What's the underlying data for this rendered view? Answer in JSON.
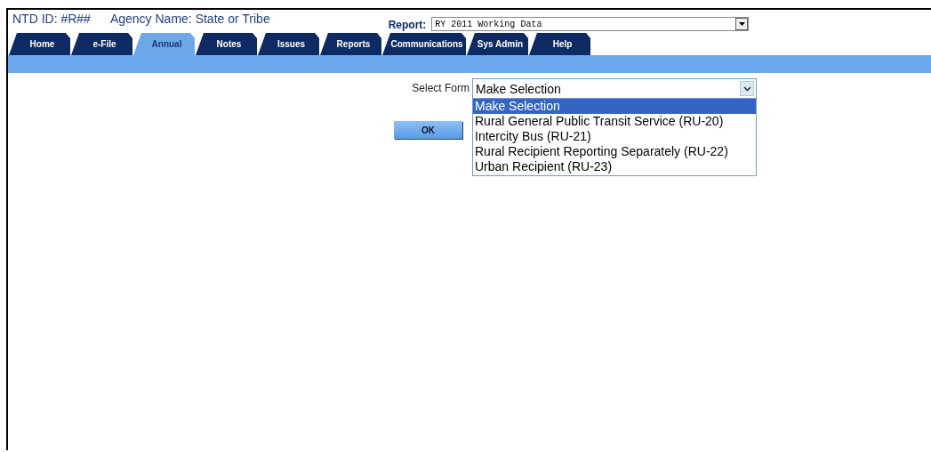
{
  "header": {
    "ntd_id": "NTD ID: #R##",
    "agency": "Agency Name: State or Tribe",
    "report_label": "Report:",
    "report_value": "RY 2011 Working Data"
  },
  "tabs": [
    {
      "label": "Home",
      "selected": false
    },
    {
      "label": "e-File",
      "selected": false
    },
    {
      "label": "Annual",
      "selected": true
    },
    {
      "label": "Notes",
      "selected": false
    },
    {
      "label": "Issues",
      "selected": false
    },
    {
      "label": "Reports",
      "selected": false
    },
    {
      "label": "Communications",
      "selected": false
    },
    {
      "label": "Sys Admin",
      "selected": false
    },
    {
      "label": "Help",
      "selected": false
    }
  ],
  "form": {
    "label": "Select Form",
    "value": "Make Selection",
    "options": [
      {
        "label": "Make Selection",
        "selected": true
      },
      {
        "label": "Rural General Public Transit Service (RU-20)",
        "selected": false
      },
      {
        "label": "Intercity Bus (RU-21)",
        "selected": false
      },
      {
        "label": "Rural Recipient Reporting Separately (RU-22)",
        "selected": false
      },
      {
        "label": "Urban Recipient (RU-23)",
        "selected": false
      }
    ],
    "ok_button": "OK"
  }
}
